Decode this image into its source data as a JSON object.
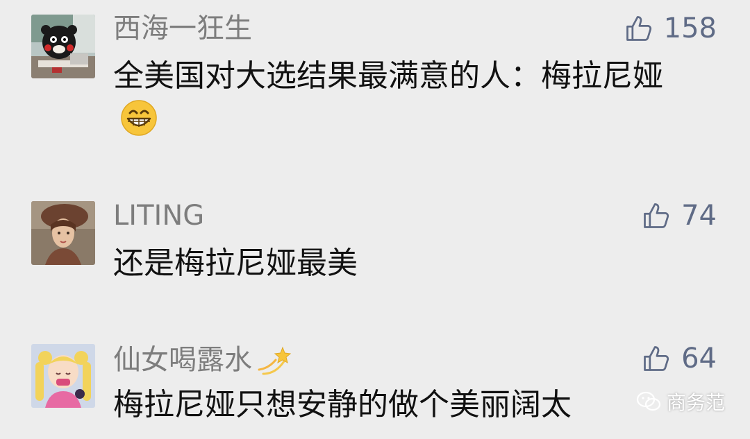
{
  "comments": [
    {
      "username": "西海一狂生",
      "likes": "158",
      "text": "全美国对大选结果最满意的人：梅拉尼娅",
      "avatar": "kumamon-avatar",
      "trailing_emoji": "grinning-face-icon"
    },
    {
      "username": "LITING",
      "likes": "74",
      "text": "还是梅拉尼娅最美",
      "avatar": "woman-hat-avatar"
    },
    {
      "username": "仙女喝露水",
      "likes": "64",
      "text": "梅拉尼娅只想安静的做个美丽阔太",
      "avatar": "sailor-moon-avatar",
      "name_emoji": "sparkle-star-icon"
    }
  ],
  "watermark": {
    "text": "商务范",
    "icon": "wechat-icon"
  },
  "colors": {
    "background": "#ededed",
    "username": "#7d7d7d",
    "like": "#5f6b86",
    "text": "#111111"
  }
}
